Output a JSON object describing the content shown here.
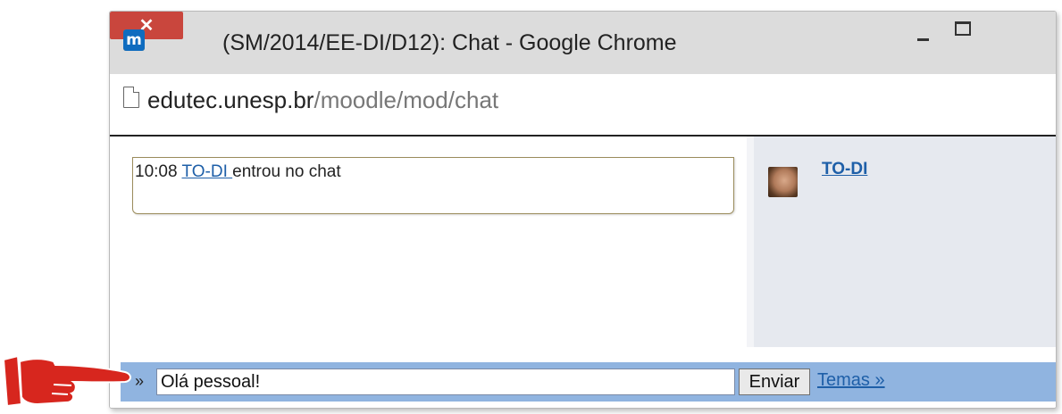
{
  "window": {
    "title": "(SM/2014/EE-DI/D12): Chat - Google Chrome",
    "app_icon_glyph": "m",
    "close_glyph": "✕"
  },
  "addressbar": {
    "host": "edutec.unesp.br",
    "path": "/moodle/mod/chat"
  },
  "messages": [
    {
      "time": "10:08",
      "user": "TO-DI ",
      "text": " entrou no chat"
    }
  ],
  "users": [
    {
      "name": "TO-DI"
    }
  ],
  "input": {
    "prefix": "»",
    "value": "Olá pessoal!",
    "send_label": "Enviar",
    "themes_label": "Temas »"
  },
  "colors": {
    "accent": "#1e5fa8",
    "input_bar": "#90b4e0",
    "users_panel": "#e6e9ef",
    "close_button": "#c9463d",
    "pointer": "#d7261e"
  },
  "icons": [
    "moodle-app-icon",
    "page-icon",
    "minimize-icon",
    "maximize-icon",
    "close-icon",
    "pointing-hand-icon"
  ]
}
